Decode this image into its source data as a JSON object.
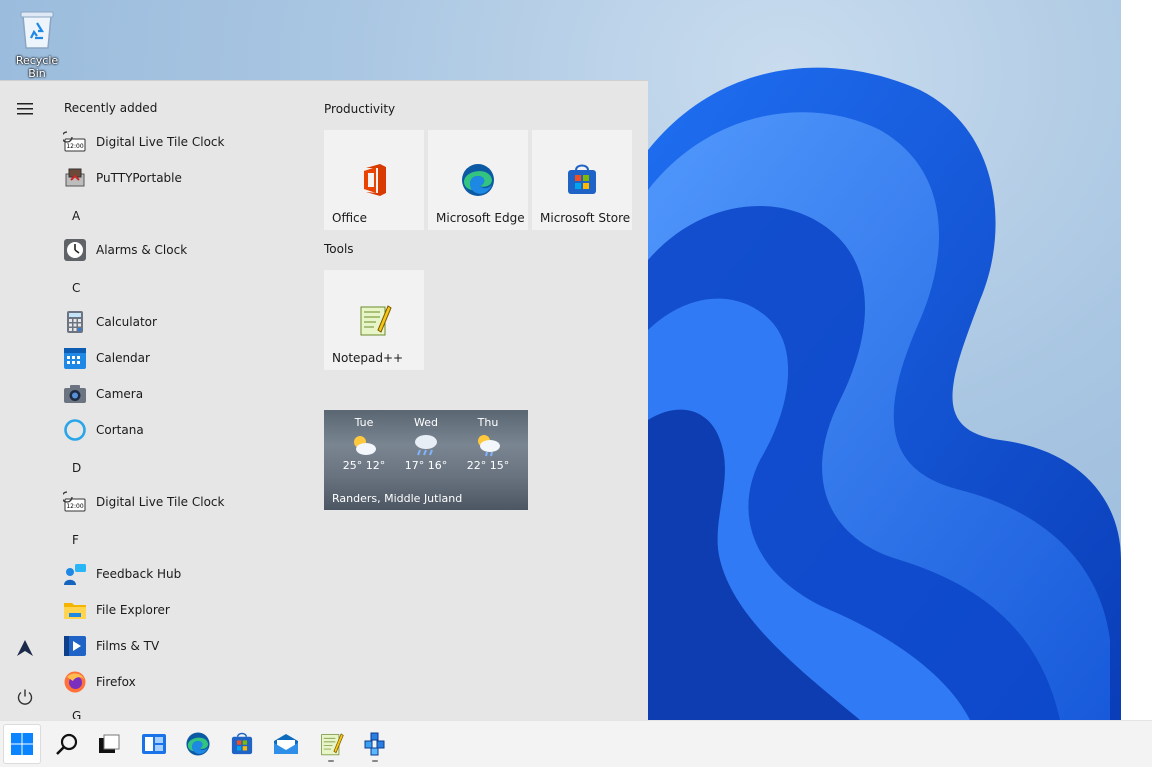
{
  "desktop": {
    "icons": [
      {
        "label": "Recycle Bin",
        "icon": "recycle-bin-icon"
      }
    ]
  },
  "start_menu": {
    "rail": {
      "menu_icon": "hamburger-icon",
      "user_icon": "arrow-user-icon",
      "power_icon": "power-icon"
    },
    "recently_added_title": "Recently added",
    "recent_apps": [
      {
        "name": "Digital Live Tile Clock",
        "icon": "digital-clock-icon"
      },
      {
        "name": "PuTTYPortable",
        "icon": "putty-icon"
      }
    ],
    "groups": [
      {
        "letter": "A",
        "apps": [
          {
            "name": "Alarms & Clock",
            "icon": "alarm-clock-icon"
          }
        ]
      },
      {
        "letter": "C",
        "apps": [
          {
            "name": "Calculator",
            "icon": "calculator-icon"
          },
          {
            "name": "Calendar",
            "icon": "calendar-icon"
          },
          {
            "name": "Camera",
            "icon": "camera-icon"
          },
          {
            "name": "Cortana",
            "icon": "cortana-icon"
          }
        ]
      },
      {
        "letter": "D",
        "apps": [
          {
            "name": "Digital Live Tile Clock",
            "icon": "digital-clock-icon"
          }
        ]
      },
      {
        "letter": "F",
        "apps": [
          {
            "name": "Feedback Hub",
            "icon": "feedback-hub-icon"
          },
          {
            "name": "File Explorer",
            "icon": "file-explorer-icon"
          },
          {
            "name": "Films & TV",
            "icon": "films-tv-icon"
          },
          {
            "name": "Firefox",
            "icon": "firefox-icon"
          }
        ]
      },
      {
        "letter": "G",
        "apps": []
      }
    ],
    "tile_groups": [
      {
        "title": "Productivity",
        "tiles": [
          {
            "label": "Office",
            "icon": "office-icon"
          },
          {
            "label": "Microsoft Edge",
            "icon": "edge-icon"
          },
          {
            "label": "Microsoft Store",
            "icon": "store-icon"
          }
        ]
      },
      {
        "title": "Tools",
        "tiles": [
          {
            "label": "Notepad++",
            "icon": "notepadpp-icon"
          }
        ]
      }
    ],
    "weather": {
      "days": [
        {
          "day": "Tue",
          "temps": "25° 12°",
          "icon": "partly-sunny-icon"
        },
        {
          "day": "Wed",
          "temps": "17° 16°",
          "icon": "rain-icon"
        },
        {
          "day": "Thu",
          "temps": "22° 15°",
          "icon": "sun-showers-icon"
        }
      ],
      "location": "Randers, Middle Jutland"
    }
  },
  "taskbar": {
    "items": [
      {
        "name": "start",
        "icon": "windows-start-icon",
        "active": true,
        "running": false
      },
      {
        "name": "search",
        "icon": "search-icon",
        "active": false,
        "running": false
      },
      {
        "name": "task-view",
        "icon": "task-view-icon",
        "active": false,
        "running": false
      },
      {
        "name": "widgets",
        "icon": "widgets-icon",
        "active": false,
        "running": false
      },
      {
        "name": "edge",
        "icon": "edge-icon",
        "active": false,
        "running": false
      },
      {
        "name": "store",
        "icon": "store-icon",
        "active": false,
        "running": false
      },
      {
        "name": "mail",
        "icon": "mail-icon",
        "active": false,
        "running": false
      },
      {
        "name": "notepadpp",
        "icon": "notepadpp-icon",
        "active": false,
        "running": true
      },
      {
        "name": "config-tool",
        "icon": "gears-app-icon",
        "active": false,
        "running": true
      }
    ]
  },
  "colors": {
    "accent": "#0067c0",
    "start_menu_bg": "#e6e6e6",
    "taskbar_bg": "#f3f3f3"
  }
}
